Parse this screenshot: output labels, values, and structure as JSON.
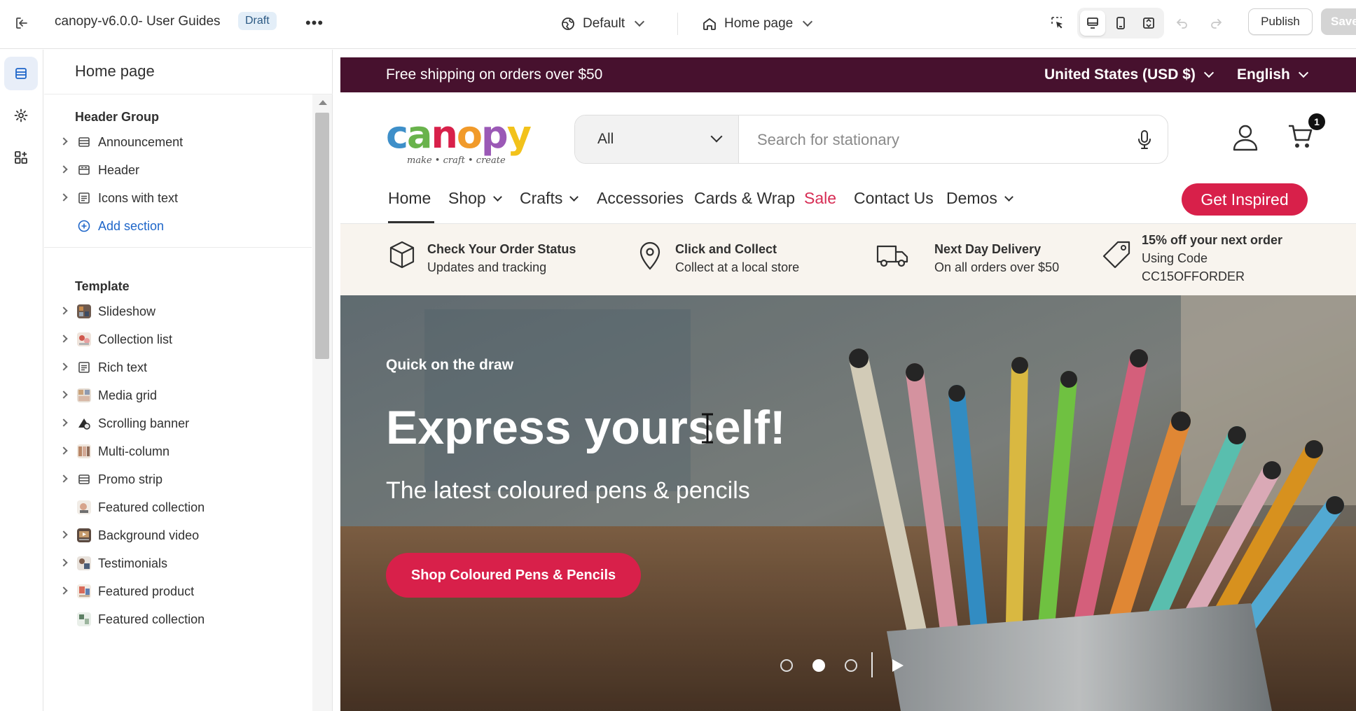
{
  "topbar": {
    "theme_name": "canopy-v6.0.0- User Guides",
    "status_badge": "Draft",
    "more_label": "•••",
    "locale_selector": "Default",
    "page_selector": "Home page",
    "publish_label": "Publish",
    "save_label": "Save"
  },
  "sidebar": {
    "title": "Home page",
    "header_group": {
      "heading": "Header Group",
      "items": [
        {
          "label": "Announcement",
          "icon": "section-layout-icon"
        },
        {
          "label": "Header",
          "icon": "header-layout-icon"
        },
        {
          "label": "Icons with text",
          "icon": "section-layout-icon"
        }
      ],
      "add_label": "Add section"
    },
    "template": {
      "heading": "Template",
      "items": [
        {
          "label": "Slideshow",
          "icon": "slideshow-thumb"
        },
        {
          "label": "Collection list",
          "icon": "collection-thumb"
        },
        {
          "label": "Rich text",
          "icon": "text-layout-icon"
        },
        {
          "label": "Media grid",
          "icon": "media-thumb"
        },
        {
          "label": "Scrolling banner",
          "icon": "banner-thumb"
        },
        {
          "label": "Multi-column",
          "icon": "multicolumn-thumb"
        },
        {
          "label": "Promo strip",
          "icon": "section-layout-icon"
        },
        {
          "label": "Featured collection",
          "icon": "featured-thumb"
        },
        {
          "label": "Background video",
          "icon": "video-thumb"
        },
        {
          "label": "Testimonials",
          "icon": "testimonial-thumb"
        },
        {
          "label": "Featured product",
          "icon": "product-thumb"
        },
        {
          "label": "Featured collection",
          "icon": "featured-thumb"
        }
      ]
    }
  },
  "store": {
    "announcement": {
      "text": "Free shipping on orders over $50",
      "currency": "United States (USD $)",
      "language": "English"
    },
    "logo": {
      "word": "canopy",
      "tagline": "make • craft • create"
    },
    "search": {
      "category": "All",
      "placeholder": "Search for stationary"
    },
    "cart_count": "1",
    "nav": {
      "items": [
        {
          "label": "Home"
        },
        {
          "label": "Shop"
        },
        {
          "label": "Crafts"
        },
        {
          "label": "Accessories"
        },
        {
          "label": "Cards & Wrap"
        },
        {
          "label": "Sale"
        },
        {
          "label": "Contact Us"
        },
        {
          "label": "Demos"
        }
      ],
      "cta": "Get Inspired"
    },
    "usps": [
      {
        "title": "Check Your Order Status",
        "subtitle": "Updates and tracking"
      },
      {
        "title": "Click and Collect",
        "subtitle": "Collect at a local store"
      },
      {
        "title": "Next Day Delivery",
        "subtitle": "On all orders over $50"
      },
      {
        "title": "15% off your next order",
        "subtitle": "Using Code",
        "subtitle2": "CC15OFFORDER"
      }
    ],
    "hero": {
      "kicker": "Quick on the draw",
      "title": "Express yourself!",
      "subtitle": "The latest coloured pens & pencils",
      "button": "Shop Coloured Pens & Pencils",
      "slide_count": 3,
      "active_slide": 2
    }
  },
  "colors": {
    "announcement_bg": "#47112e",
    "accent": "#d8204a",
    "sale": "#d72c54",
    "usp_bg": "#f8f4ee",
    "editor_link": "#1e66c9"
  }
}
